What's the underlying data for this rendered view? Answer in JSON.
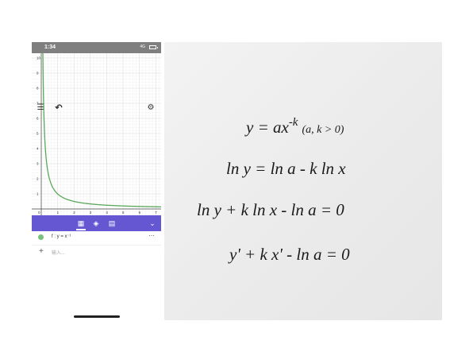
{
  "status_bar": {
    "time": "1:34",
    "network": "4G"
  },
  "graph": {
    "y_ticks": [
      "1",
      "2",
      "3",
      "4",
      "5",
      "6",
      "7",
      "8",
      "9",
      "10"
    ],
    "x_ticks": [
      "1",
      "2",
      "3",
      "4",
      "5",
      "6",
      "7"
    ],
    "origin_label": "0",
    "curve_color": "#5aa85c"
  },
  "toolbar": {
    "menu_icon": "menu-icon",
    "undo_icon": "undo-icon",
    "settings_icon": "gear-icon"
  },
  "bottom_tabs": {
    "accent_color": "#6557d2",
    "tabs": [
      "calculator-icon",
      "tools-icon",
      "table-icon"
    ],
    "collapse_icon": "chevron-down-icon"
  },
  "functions": [
    {
      "label": "f : y = x⁻¹",
      "color": "#78c17a"
    }
  ],
  "input": {
    "placeholder": "输入..."
  },
  "paper": {
    "lines": [
      "y = ax^-k (a, k > 0)",
      "ln y = ln a - k ln x",
      "ln y + k ln x - ln a = 0",
      "y' + k x' - ln a = 0"
    ]
  }
}
